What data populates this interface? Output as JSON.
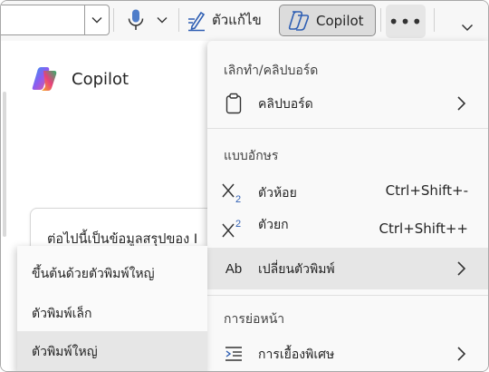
{
  "toolbar": {
    "editor_label": "ตัวแก้ไข",
    "copilot_label": "Copilot",
    "more_label": "•••"
  },
  "pane": {
    "copilot_title": "Copilot",
    "summary_text": "ต่อไปนี้เป็นข้อมูลสรุปของ I"
  },
  "menu": {
    "undo_clipboard_header": "เลิกทำ/คลิปบอร์ด",
    "clipboard_label": "คลิปบอร์ด",
    "font_header": "แบบอักษร",
    "subscript_label": "ตัวห้อย",
    "subscript_shortcut": "Ctrl+Shift+-",
    "superscript_label": "ตัวยก",
    "superscript_shortcut": "Ctrl+Shift++",
    "change_case_label": "เปลี่ยนตัวพิมพ์",
    "change_case_icon_text": "Ab",
    "paragraph_header": "การย่อหน้า",
    "indent_label": "การเยื้องพิเศษ"
  },
  "submenu": {
    "items": [
      "ขึ้นต้นด้วยตัวพิมพ์ใหญ่",
      "ตัวพิมพ์เล็ก",
      "ตัวพิมพ์ใหญ่"
    ]
  },
  "colors": {
    "toolbar_bg": "#f7f7f7",
    "menu_bg": "#f9f9f9",
    "highlight_bg": "#e6e6e6",
    "mic_blue": "#4f7dc9",
    "editor_blue": "#2f5fb3"
  },
  "icons": {
    "mic": "microphone-icon",
    "editor": "pen-editor-icon",
    "copilot": "copilot-logo-icon",
    "clipboard": "clipboard-icon",
    "subscript": "subscript-icon",
    "superscript": "superscript-icon",
    "indent": "indent-icon",
    "chevron": "chevron-right-icon"
  }
}
